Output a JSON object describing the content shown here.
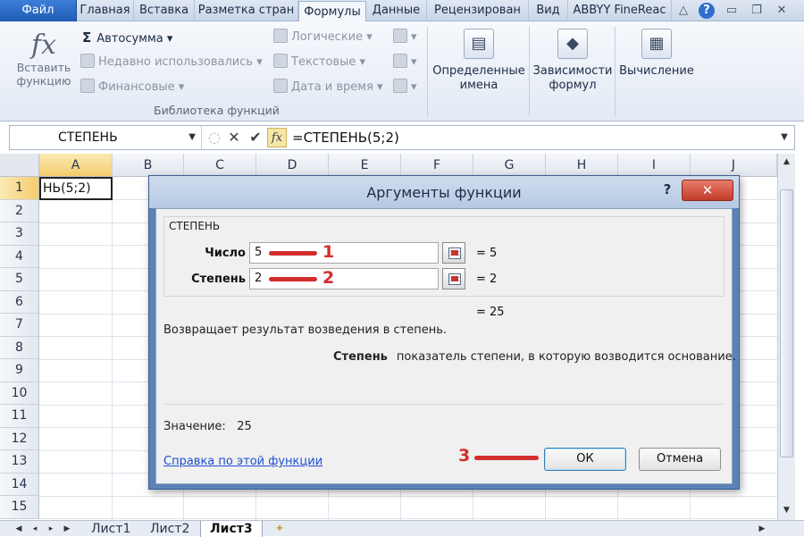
{
  "ribbon_tabs": [
    "Файл",
    "Главная",
    "Вставка",
    "Разметка стран",
    "Формулы",
    "Данные",
    "Рецензирован",
    "Вид",
    "ABBYY FineReac"
  ],
  "ribbon": {
    "insert_function": "Вставить функцию",
    "autosum": "Автосумма",
    "recent": "Недавно использовались",
    "financial": "Финансовые",
    "logical": "Логические",
    "text": "Текстовые",
    "datetime": "Дата и время",
    "group_label": "Библиотека функций",
    "defined_names": "Определенные имена",
    "dependencies": "Зависимости формул",
    "calculation": "Вычисление"
  },
  "formula_bar": {
    "name_box": "СТЕПЕНЬ",
    "formula": "=СТЕПЕНЬ(5;2)"
  },
  "grid": {
    "columns": [
      "A",
      "B",
      "C",
      "D",
      "E",
      "F",
      "G",
      "H",
      "I",
      "J"
    ],
    "rows": [
      "1",
      "2",
      "3",
      "4",
      "5",
      "6",
      "7",
      "8",
      "9",
      "10",
      "11",
      "12",
      "13",
      "14",
      "15"
    ],
    "cell_a1": "НЬ(5;2)"
  },
  "sheets": [
    "Лист1",
    "Лист2",
    "Лист3"
  ],
  "dialog": {
    "title": "Аргументы функции",
    "help_glyph": "?",
    "close_glyph": "✕",
    "function_name": "СТЕПЕНЬ",
    "args": [
      {
        "label": "Число",
        "value": "5",
        "result": "=  5",
        "marker": "1"
      },
      {
        "label": "Степень",
        "value": "2",
        "result": "=  2",
        "marker": "2"
      }
    ],
    "result": "=  25",
    "description": "Возвращает результат возведения в степень.",
    "arg_desc_name": "Степень",
    "arg_desc_text": "показатель степени, в которую возводится основание.",
    "value_label": "Значение:",
    "value": "25",
    "help_link": "Справка по этой функции",
    "ok_marker": "3",
    "ok": "ОК",
    "cancel": "Отмена"
  },
  "colors": {
    "annotation_red": "#d22d2d",
    "dialog_frame": "#5b82b5",
    "file_tab": "#2a6bc7"
  }
}
